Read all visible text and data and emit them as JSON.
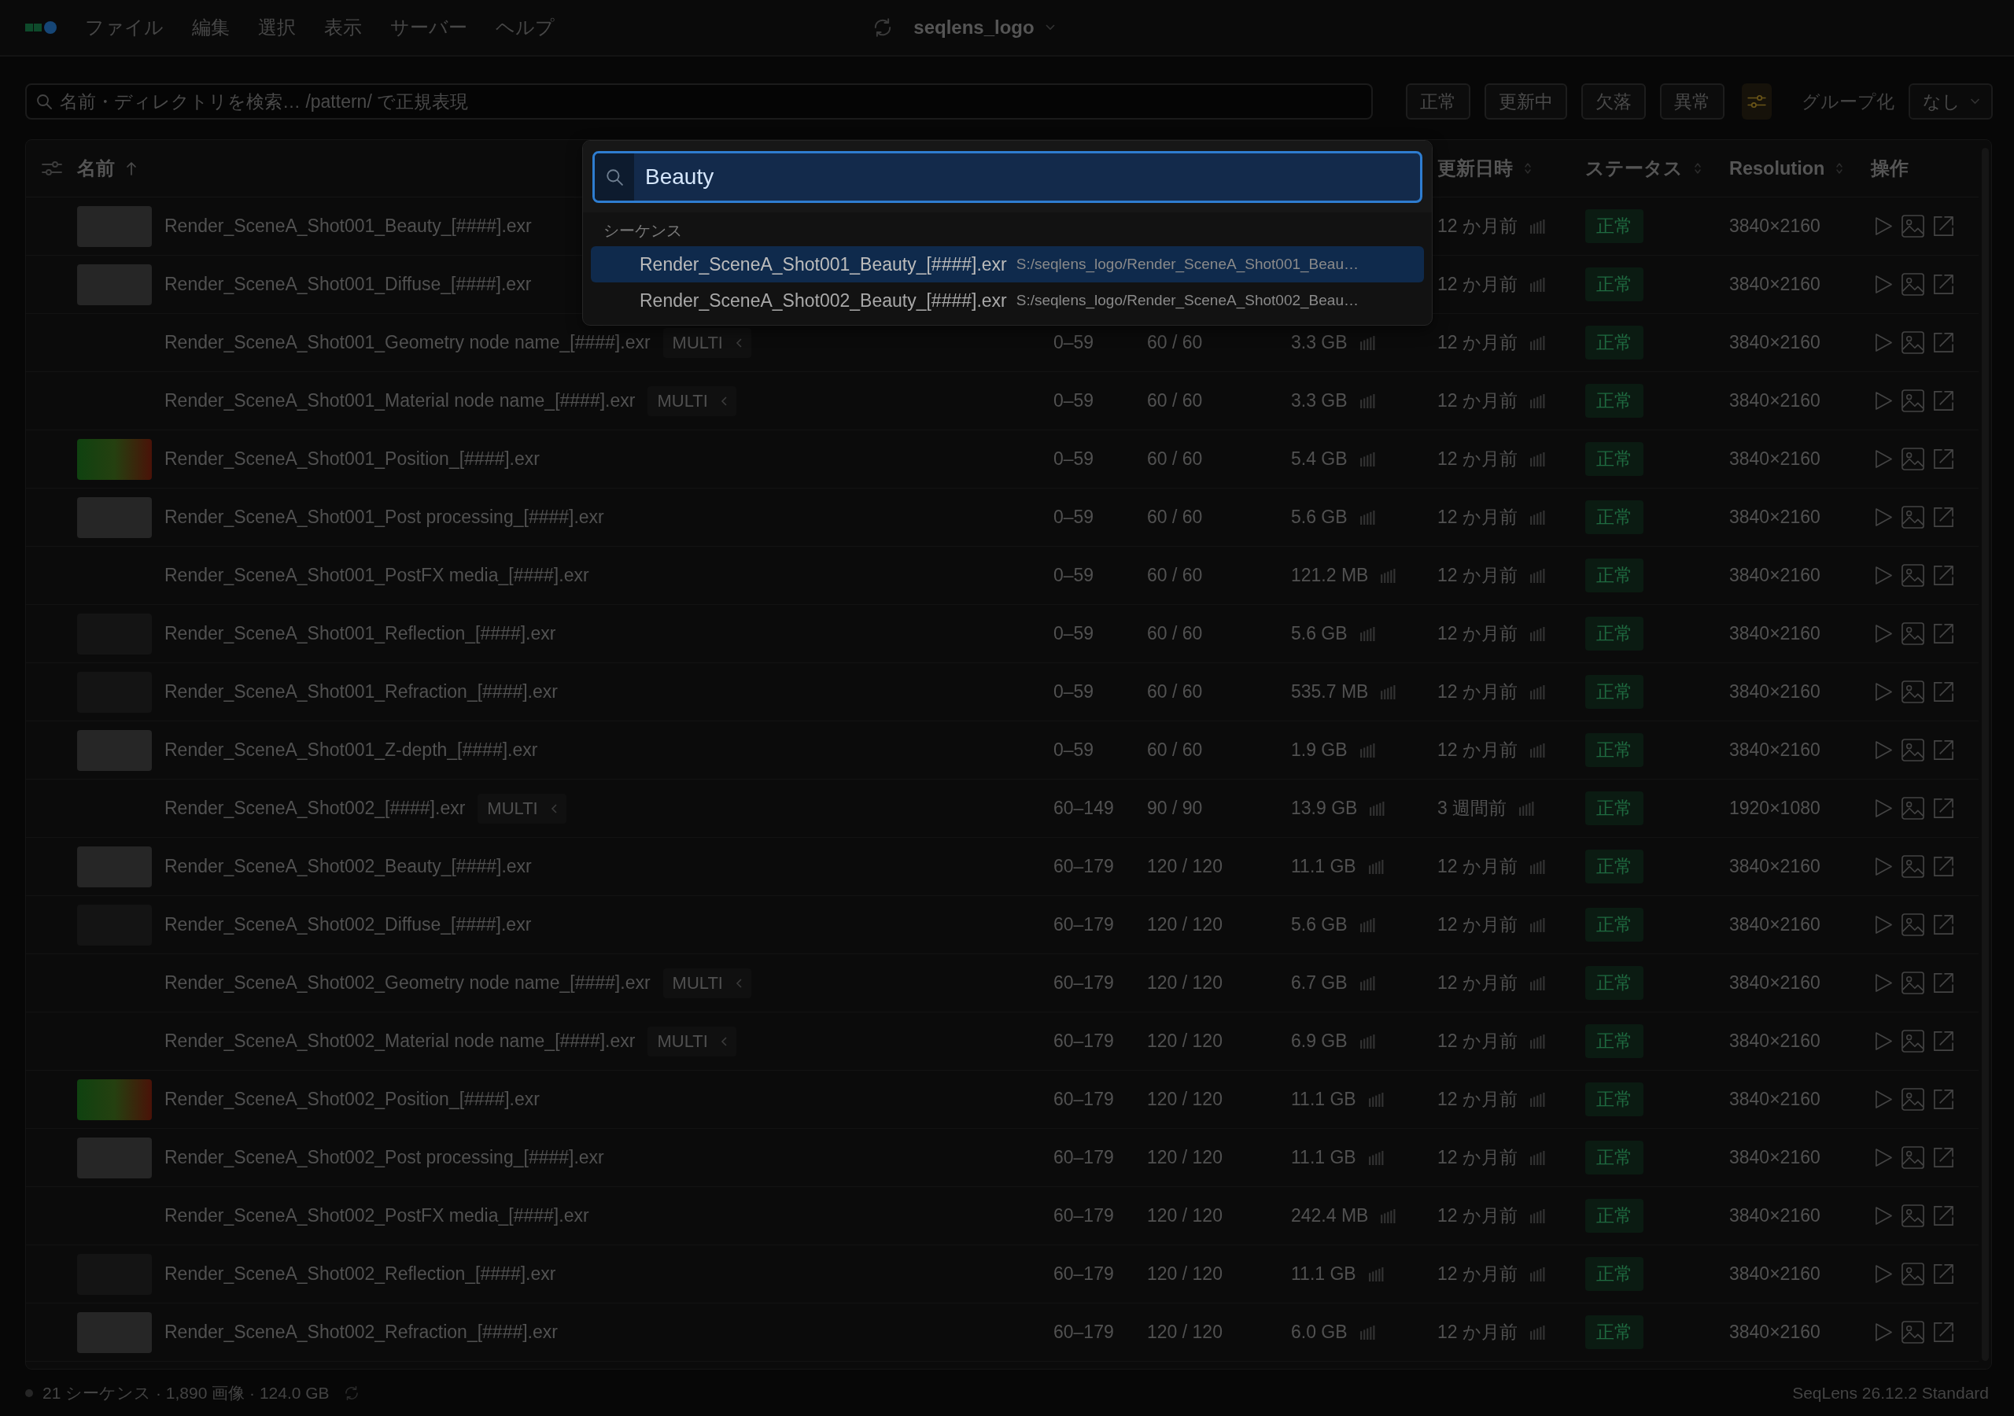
{
  "menubar": {
    "menus": [
      "ファイル",
      "編集",
      "選択",
      "表示",
      "サーバー",
      "ヘルプ"
    ],
    "project": "seqlens_logo"
  },
  "toolbar": {
    "search": {
      "placeholder": "名前・ディレクトリを検索… /pattern/ で正規表現"
    },
    "filters": [
      {
        "label": "正常",
        "selected": false
      },
      {
        "label": "更新中",
        "selected": false
      },
      {
        "label": "欠落",
        "selected": false
      },
      {
        "label": "異常",
        "selected": false
      }
    ],
    "filter_button": {
      "active": true
    },
    "group_label": "グループ化",
    "group_value": "なし"
  },
  "table": {
    "headers": {
      "name": {
        "label": "名前",
        "sorted": true
      },
      "updated": {
        "label": "更新日時",
        "sorted": false
      },
      "status": {
        "label": "ステータス",
        "sorted": false
      },
      "resolution": {
        "label": "Resolution",
        "sorted": false
      },
      "actions": {
        "label": "操作"
      }
    },
    "rows": [
      {
        "kind": "plain",
        "name": "Render_SceneA_Shot001_Beauty_[####].exr",
        "updated": "12 か月前",
        "status": "正常",
        "resolution": "3840×2160"
      },
      {
        "kind": "plain",
        "name": "Render_SceneA_Shot001_Diffuse_[####].exr",
        "updated": "12 か月前",
        "status": "正常",
        "resolution": "3840×2160"
      },
      {
        "kind": "none",
        "name": "Render_SceneA_Shot001_Geometry node name_[####].exr",
        "tag": "MULTI",
        "range": "0–59",
        "frames": "60 / 60",
        "size": "3.3 GB",
        "updated": "12 か月前",
        "status": "正常",
        "resolution": "3840×2160"
      },
      {
        "kind": "none",
        "name": "Render_SceneA_Shot001_Material node name_[####].exr",
        "tag": "MULTI",
        "range": "0–59",
        "frames": "60 / 60",
        "size": "3.3 GB",
        "updated": "12 か月前",
        "status": "正常",
        "resolution": "3840×2160"
      },
      {
        "kind": "gradient",
        "name": "Render_SceneA_Shot001_Position_[####].exr",
        "range": "0–59",
        "frames": "60 / 60",
        "size": "5.4 GB",
        "updated": "12 か月前",
        "status": "正常",
        "resolution": "3840×2160"
      },
      {
        "kind": "plain",
        "name": "Render_SceneA_Shot001_Post processing_[####].exr",
        "range": "0–59",
        "frames": "60 / 60",
        "size": "5.6 GB",
        "updated": "12 か月前",
        "status": "正常",
        "resolution": "3840×2160"
      },
      {
        "kind": "none",
        "name": "Render_SceneA_Shot001_PostFX media_[####].exr",
        "range": "0–59",
        "frames": "60 / 60",
        "size": "121.2 MB",
        "updated": "12 か月前",
        "status": "正常",
        "resolution": "3840×2160"
      },
      {
        "kind": "dark",
        "name": "Render_SceneA_Shot001_Reflection_[####].exr",
        "range": "0–59",
        "frames": "60 / 60",
        "size": "5.6 GB",
        "updated": "12 か月前",
        "status": "正常",
        "resolution": "3840×2160"
      },
      {
        "kind": "dark",
        "name": "Render_SceneA_Shot001_Refraction_[####].exr",
        "range": "0–59",
        "frames": "60 / 60",
        "size": "535.7 MB",
        "updated": "12 か月前",
        "status": "正常",
        "resolution": "3840×2160"
      },
      {
        "kind": "plain",
        "name": "Render_SceneA_Shot001_Z-depth_[####].exr",
        "range": "0–59",
        "frames": "60 / 60",
        "size": "1.9 GB",
        "updated": "12 か月前",
        "status": "正常",
        "resolution": "3840×2160"
      },
      {
        "kind": "none",
        "name": "Render_SceneA_Shot002_[####].exr",
        "tag": "MULTI",
        "range": "60–149",
        "frames": "90 / 90",
        "size": "13.9 GB",
        "updated": "3 週間前",
        "status": "正常",
        "resolution": "1920×1080"
      },
      {
        "kind": "plain",
        "name": "Render_SceneA_Shot002_Beauty_[####].exr",
        "range": "60–179",
        "frames": "120 / 120",
        "size": "11.1 GB",
        "updated": "12 か月前",
        "status": "正常",
        "resolution": "3840×2160"
      },
      {
        "kind": "dark",
        "name": "Render_SceneA_Shot002_Diffuse_[####].exr",
        "range": "60–179",
        "frames": "120 / 120",
        "size": "5.6 GB",
        "updated": "12 か月前",
        "status": "正常",
        "resolution": "3840×2160"
      },
      {
        "kind": "none",
        "name": "Render_SceneA_Shot002_Geometry node name_[####].exr",
        "tag": "MULTI",
        "range": "60–179",
        "frames": "120 / 120",
        "size": "6.7 GB",
        "updated": "12 か月前",
        "status": "正常",
        "resolution": "3840×2160"
      },
      {
        "kind": "none",
        "name": "Render_SceneA_Shot002_Material node name_[####].exr",
        "tag": "MULTI",
        "range": "60–179",
        "frames": "120 / 120",
        "size": "6.9 GB",
        "updated": "12 か月前",
        "status": "正常",
        "resolution": "3840×2160"
      },
      {
        "kind": "gradient",
        "name": "Render_SceneA_Shot002_Position_[####].exr",
        "range": "60–179",
        "frames": "120 / 120",
        "size": "11.1 GB",
        "updated": "12 か月前",
        "status": "正常",
        "resolution": "3840×2160"
      },
      {
        "kind": "plain",
        "name": "Render_SceneA_Shot002_Post processing_[####].exr",
        "range": "60–179",
        "frames": "120 / 120",
        "size": "11.1 GB",
        "updated": "12 か月前",
        "status": "正常",
        "resolution": "3840×2160"
      },
      {
        "kind": "none",
        "name": "Render_SceneA_Shot002_PostFX media_[####].exr",
        "range": "60–179",
        "frames": "120 / 120",
        "size": "242.4 MB",
        "updated": "12 か月前",
        "status": "正常",
        "resolution": "3840×2160"
      },
      {
        "kind": "dark",
        "name": "Render_SceneA_Shot002_Reflection_[####].exr",
        "range": "60–179",
        "frames": "120 / 120",
        "size": "11.1 GB",
        "updated": "12 か月前",
        "status": "正常",
        "resolution": "3840×2160"
      },
      {
        "kind": "plain",
        "name": "Render_SceneA_Shot002_Refraction_[####].exr",
        "range": "60–179",
        "frames": "120 / 120",
        "size": "6.0 GB",
        "updated": "12 か月前",
        "status": "正常",
        "resolution": "3840×2160"
      }
    ]
  },
  "palette": {
    "query": "Beauty",
    "section": "シーケンス",
    "items": [
      {
        "name": "Render_SceneA_Shot001_Beauty_[####].exr",
        "path": "S:/seqlens_logo/Render_SceneA_Shot001_Beau…",
        "selected": true
      },
      {
        "name": "Render_SceneA_Shot002_Beauty_[####].exr",
        "path": "S:/seqlens_logo/Render_SceneA_Shot002_Beau…",
        "selected": false
      }
    ]
  },
  "status_bar": {
    "summary": "21 シーケンス · 1,890 画像 · 124.0 GB",
    "version": "SeqLens 26.12.2 Standard"
  }
}
